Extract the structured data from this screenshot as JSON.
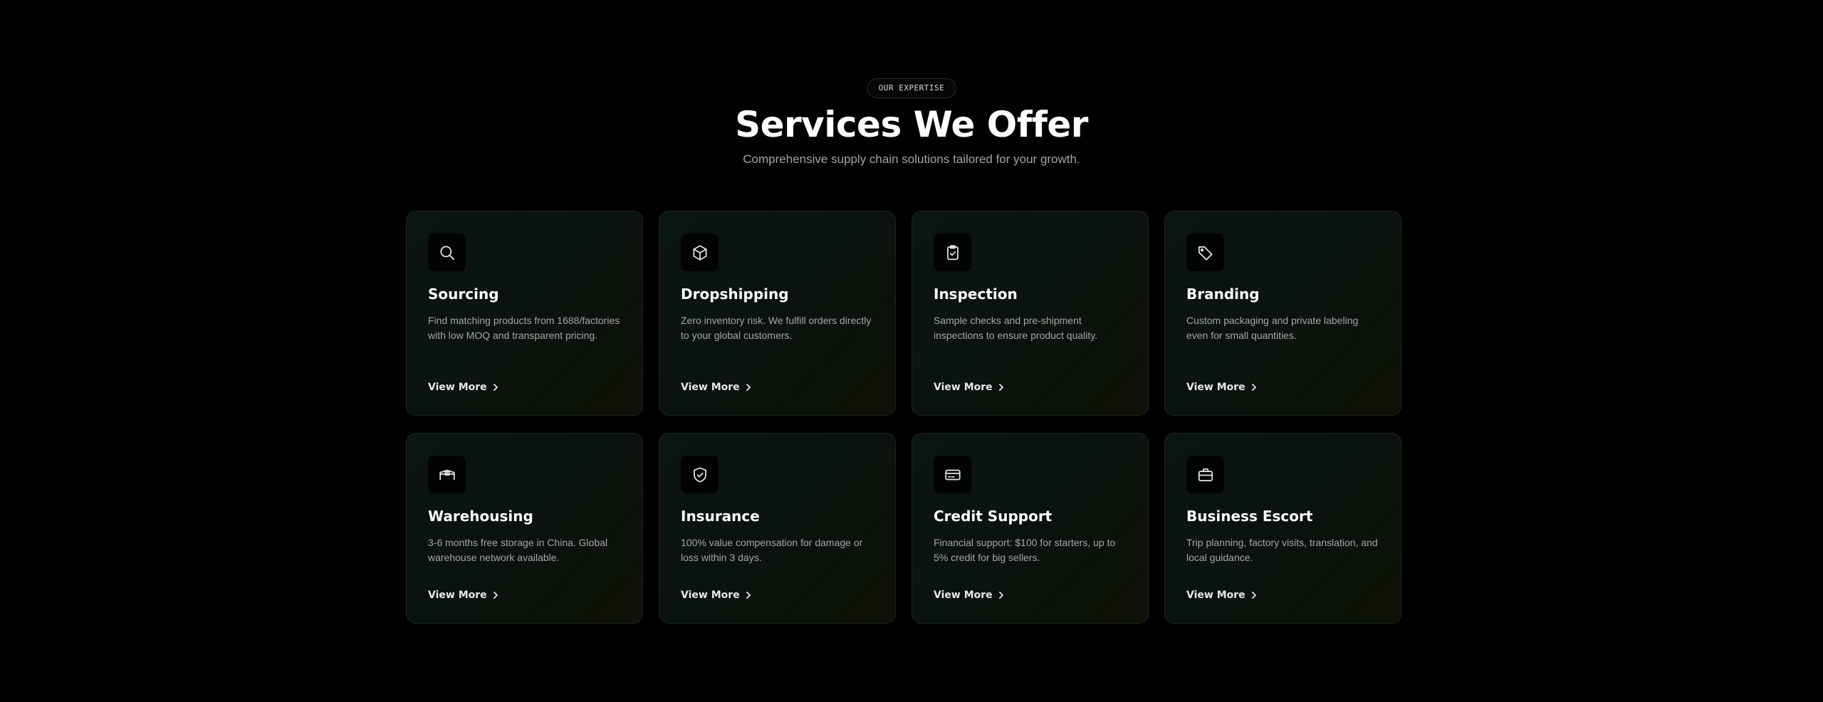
{
  "header": {
    "eyebrow": "OUR EXPERTISE",
    "title": "Services We Offer",
    "subtitle": "Comprehensive supply chain solutions tailored for your growth."
  },
  "services": [
    {
      "icon": "search-icon",
      "title": "Sourcing",
      "description": "Find matching products from 1688/factories with low MOQ and transparent pricing.",
      "link_label": "View More"
    },
    {
      "icon": "box-icon",
      "title": "Dropshipping",
      "description": "Zero inventory risk. We fulfill orders directly to your global customers.",
      "link_label": "View More"
    },
    {
      "icon": "clipboard-check-icon",
      "title": "Inspection",
      "description": "Sample checks and pre-shipment inspections to ensure product quality.",
      "link_label": "View More"
    },
    {
      "icon": "tag-icon",
      "title": "Branding",
      "description": "Custom packaging and private labeling even for small quantities.",
      "link_label": "View More"
    },
    {
      "icon": "warehouse-icon",
      "title": "Warehousing",
      "description": "3-6 months free storage in China. Global warehouse network available.",
      "link_label": "View More"
    },
    {
      "icon": "shield-check-icon",
      "title": "Insurance",
      "description": "100% value compensation for damage or loss within 3 days.",
      "link_label": "View More"
    },
    {
      "icon": "credit-card-icon",
      "title": "Credit Support",
      "description": "Financial support: $100 for starters, up to 5% credit for big sellers.",
      "link_label": "View More"
    },
    {
      "icon": "briefcase-icon",
      "title": "Business Escort",
      "description": "Trip planning, factory visits, translation, and local guidance.",
      "link_label": "View More"
    }
  ],
  "colors": {
    "background": "#000000",
    "card_border": "#1e2620",
    "text_primary": "#ffffff",
    "text_secondary": "#a6a6a6"
  }
}
